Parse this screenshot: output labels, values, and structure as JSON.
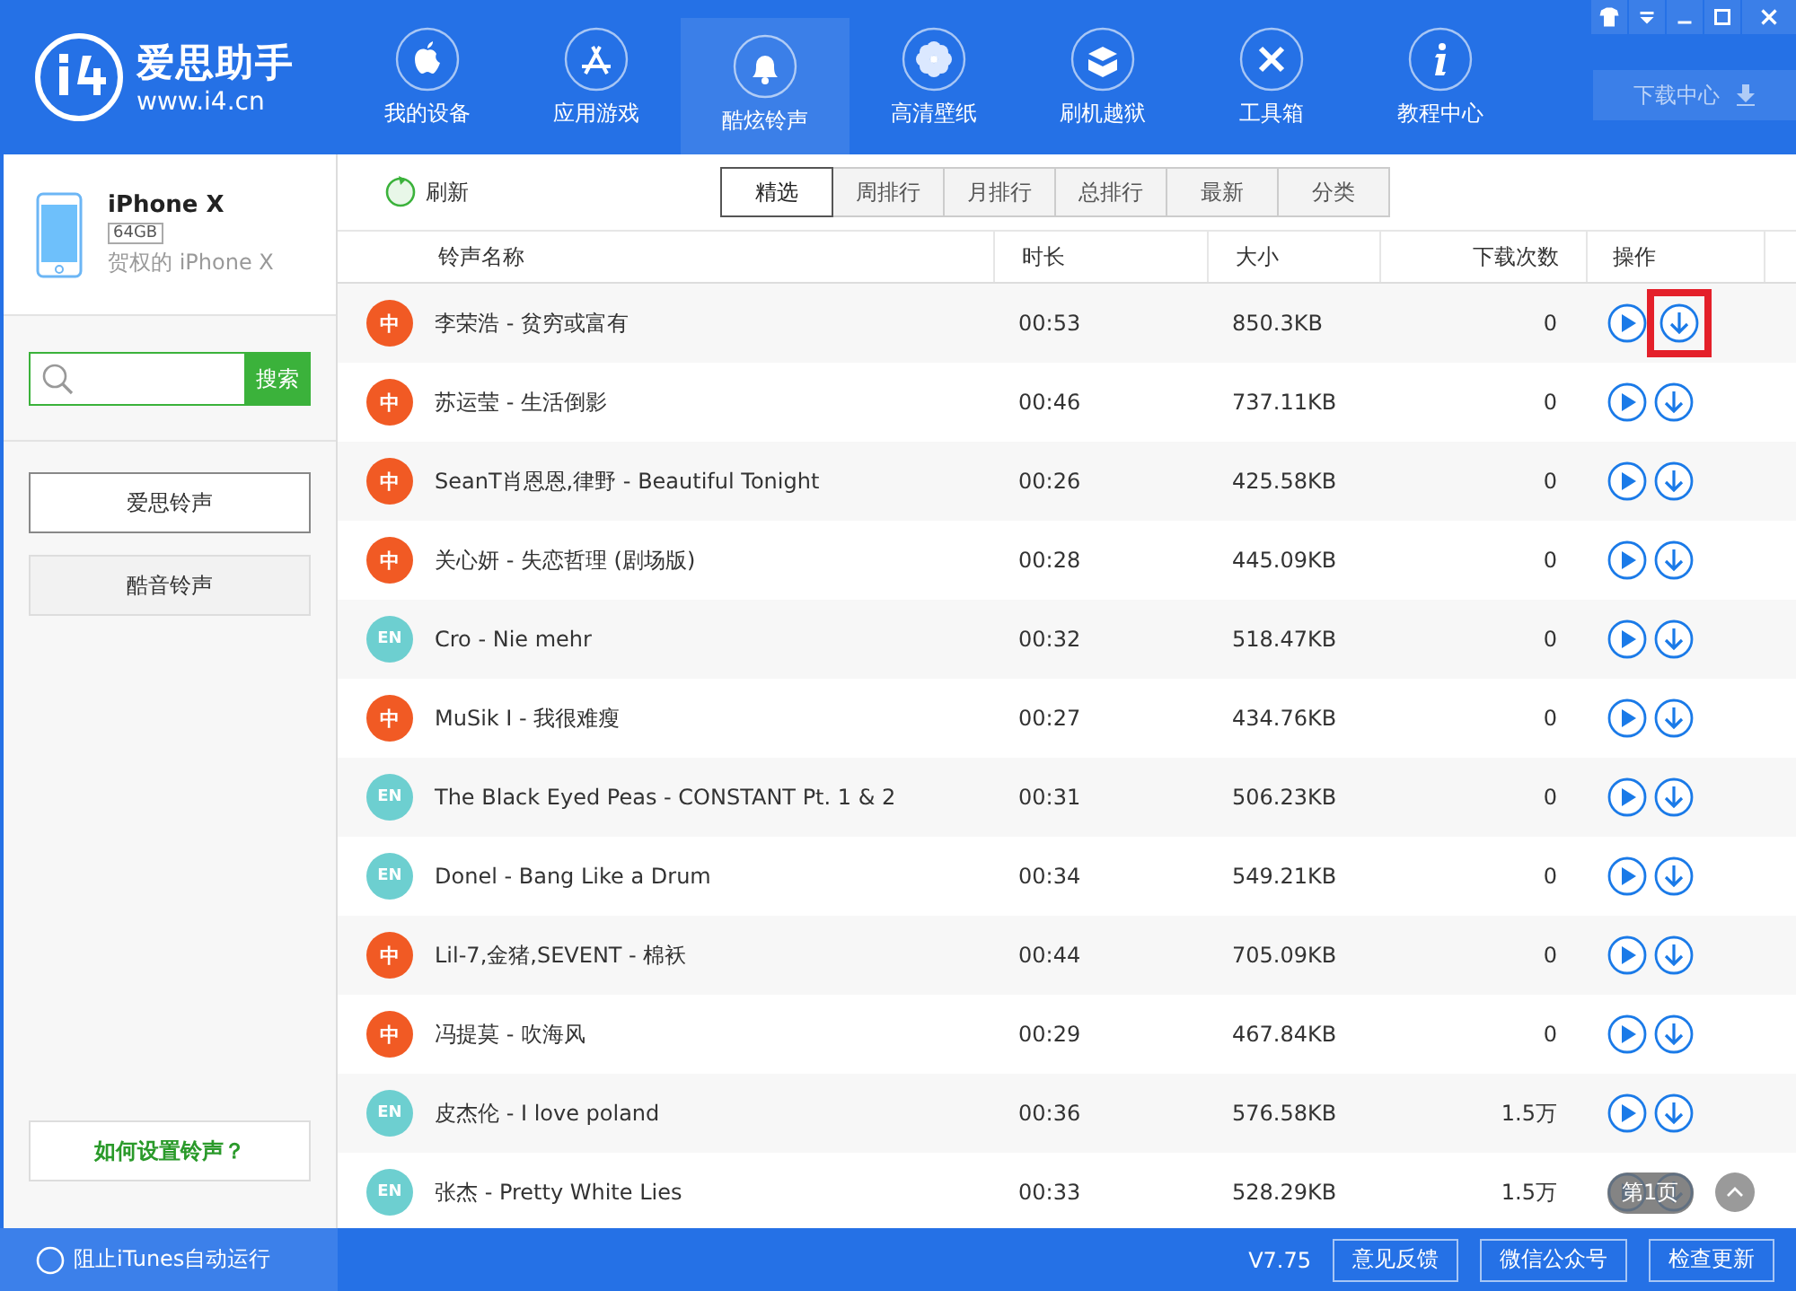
{
  "brand": {
    "name": "爱思助手",
    "url": "www.i4.cn"
  },
  "nav": [
    {
      "label": "我的设备",
      "selected": false
    },
    {
      "label": "应用游戏",
      "selected": false
    },
    {
      "label": "酷炫铃声",
      "selected": true
    },
    {
      "label": "高清壁纸",
      "selected": false
    },
    {
      "label": "刷机越狱",
      "selected": false
    },
    {
      "label": "工具箱",
      "selected": false
    },
    {
      "label": "教程中心",
      "selected": false
    }
  ],
  "download_center": "下载中心",
  "device": {
    "name": "iPhone X",
    "storage": "64GB",
    "owner": "贺权的 iPhone X"
  },
  "search": {
    "button": "搜索"
  },
  "sources": [
    {
      "label": "爱思铃声",
      "selected": true
    },
    {
      "label": "酷音铃声",
      "selected": false
    }
  ],
  "help_link": "如何设置铃声？",
  "refresh": "刷新",
  "tabs": [
    {
      "label": "精选",
      "selected": true
    },
    {
      "label": "周排行",
      "selected": false
    },
    {
      "label": "月排行",
      "selected": false
    },
    {
      "label": "总排行",
      "selected": false
    },
    {
      "label": "最新",
      "selected": false
    },
    {
      "label": "分类",
      "selected": false
    }
  ],
  "columns": [
    "铃声名称",
    "时长",
    "大小",
    "下载次数",
    "操作"
  ],
  "rows": [
    {
      "badge": "中",
      "kind": "zh",
      "name": "李荣浩 - 贫穷或富有",
      "duration": "00:53",
      "size": "850.3KB",
      "downloads": "0",
      "highlighted": true
    },
    {
      "badge": "中",
      "kind": "zh",
      "name": "苏运莹 - 生活倒影",
      "duration": "00:46",
      "size": "737.11KB",
      "downloads": "0",
      "highlighted": false
    },
    {
      "badge": "中",
      "kind": "zh",
      "name": "SeanT肖恩恩,律野 - Beautiful Tonight",
      "duration": "00:26",
      "size": "425.58KB",
      "downloads": "0",
      "highlighted": false
    },
    {
      "badge": "中",
      "kind": "zh",
      "name": "关心妍 - 失恋哲理 (剧场版)",
      "duration": "00:28",
      "size": "445.09KB",
      "downloads": "0",
      "highlighted": false
    },
    {
      "badge": "EN",
      "kind": "en",
      "name": "Cro - Nie mehr",
      "duration": "00:32",
      "size": "518.47KB",
      "downloads": "0",
      "highlighted": false
    },
    {
      "badge": "中",
      "kind": "zh",
      "name": "MuSik I - 我很难瘦",
      "duration": "00:27",
      "size": "434.76KB",
      "downloads": "0",
      "highlighted": false
    },
    {
      "badge": "EN",
      "kind": "en",
      "name": "The Black Eyed Peas - CONSTANT Pt. 1 & 2",
      "duration": "00:31",
      "size": "506.23KB",
      "downloads": "0",
      "highlighted": false
    },
    {
      "badge": "EN",
      "kind": "en",
      "name": "Donel - Bang Like a Drum",
      "duration": "00:34",
      "size": "549.21KB",
      "downloads": "0",
      "highlighted": false
    },
    {
      "badge": "中",
      "kind": "zh",
      "name": "Lil-7,金猪,SEVENT - 棉袄",
      "duration": "00:44",
      "size": "705.09KB",
      "downloads": "0",
      "highlighted": false
    },
    {
      "badge": "中",
      "kind": "zh",
      "name": "冯提莫 - 吹海风",
      "duration": "00:29",
      "size": "467.84KB",
      "downloads": "0",
      "highlighted": false
    },
    {
      "badge": "EN",
      "kind": "en",
      "name": "皮杰伦 - I love poland",
      "duration": "00:36",
      "size": "576.58KB",
      "downloads": "1.5万",
      "highlighted": false
    },
    {
      "badge": "EN",
      "kind": "en",
      "name": "张杰 - Pretty White Lies",
      "duration": "00:33",
      "size": "528.29KB",
      "downloads": "1.5万",
      "highlighted": false
    }
  ],
  "page_indicator": "第1页",
  "footer": {
    "itunes_block": {
      "label": "阻止iTunes自动运行",
      "checked": false
    },
    "version": "V7.75",
    "buttons": [
      "意见反馈",
      "微信公众号",
      "检查更新"
    ]
  }
}
